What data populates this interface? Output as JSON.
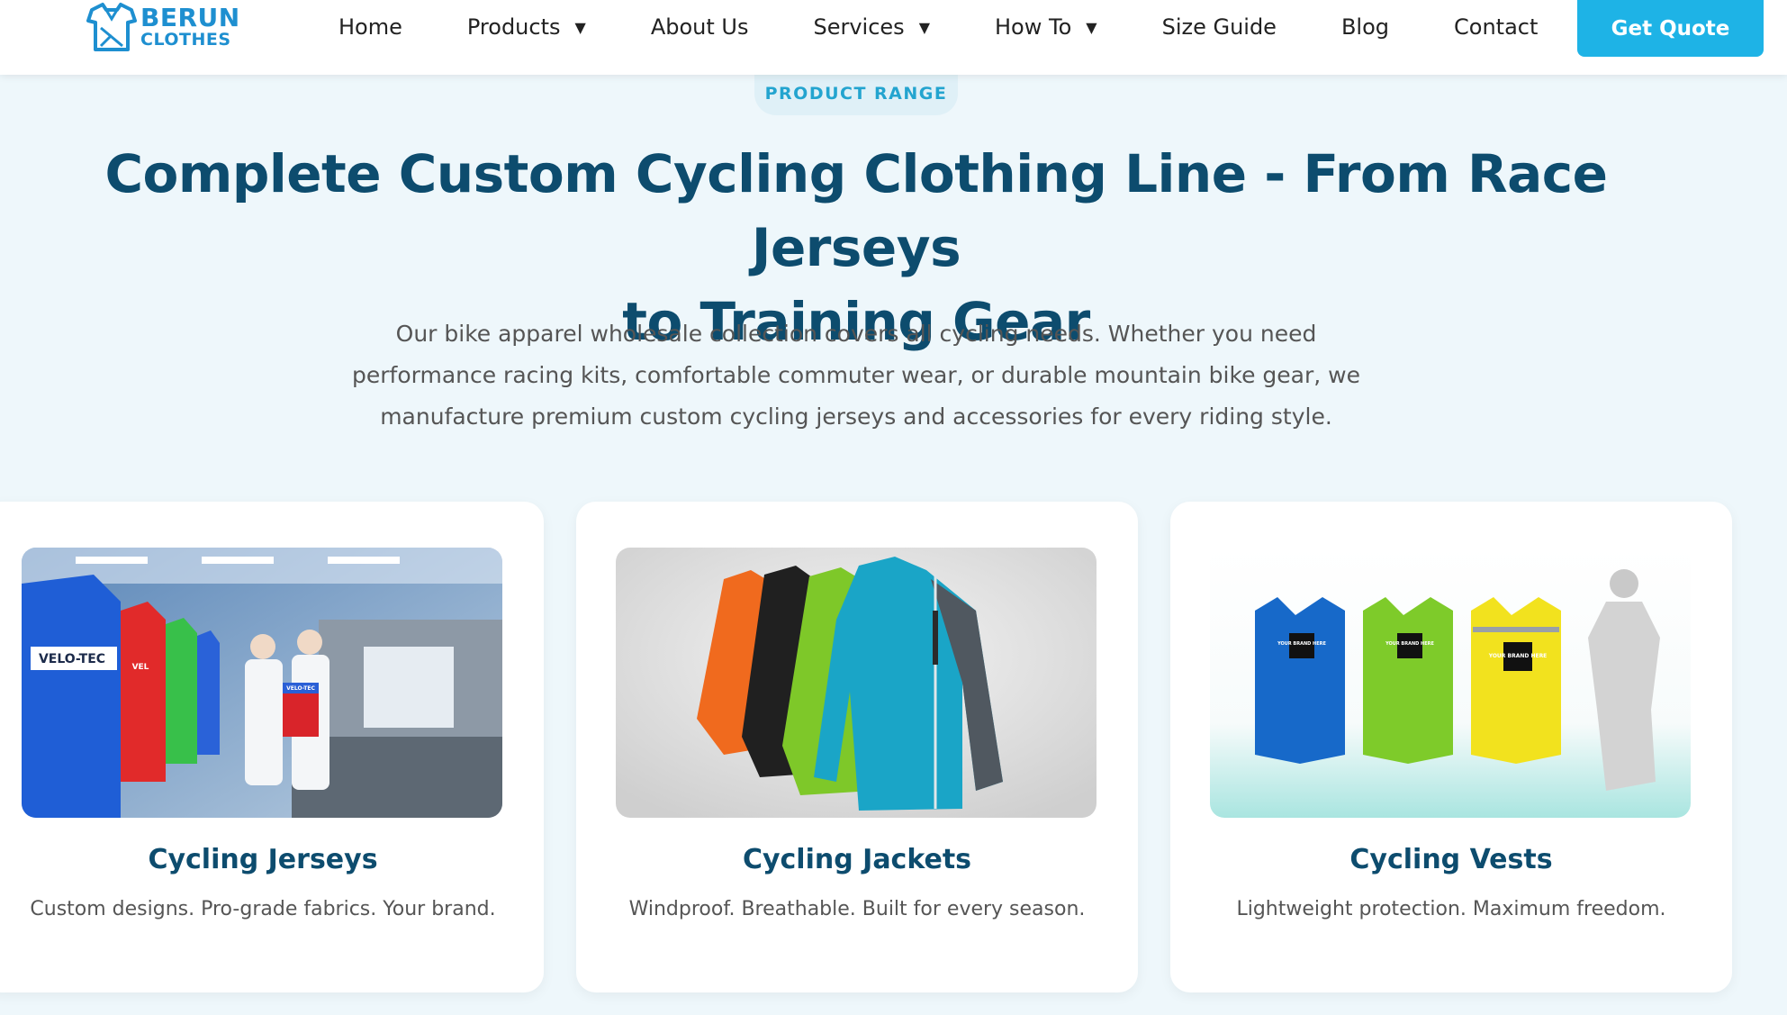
{
  "logo": {
    "brand": "BERUN",
    "sub": "CLOTHES"
  },
  "nav": {
    "items": [
      {
        "label": "Home"
      },
      {
        "label": "Products",
        "caret": "▼"
      },
      {
        "label": "About Us"
      },
      {
        "label": "Services",
        "caret": "▼"
      },
      {
        "label": "How To",
        "caret": "▼"
      },
      {
        "label": "Size Guide"
      },
      {
        "label": "Blog"
      },
      {
        "label": "Contact"
      }
    ],
    "cta": "Get Quote"
  },
  "hero": {
    "badge": "PRODUCT RANGE",
    "title_line1": "Complete Custom Cycling Clothing Line - From Race Jerseys",
    "title_line2": "to Training Gear",
    "desc_line1": "Our bike apparel wholesale collection covers all cycling needs. Whether you need",
    "desc_line2": "performance racing kits, comfortable commuter wear, or durable mountain bike gear, we",
    "desc_line3": "manufacture premium custom cycling jerseys and accessories for every riding style."
  },
  "cards": [
    {
      "title": "Cycling Jerseys",
      "desc": "Custom designs. Pro-grade fabrics. Your brand.",
      "image_text": {
        "jersey_1": "VELO-TEC",
        "jersey_2": "VEL",
        "jersey_3": "VELO-TEC"
      }
    },
    {
      "title": "Cycling Jackets",
      "desc": "Windproof. Breathable. Built for every season."
    },
    {
      "title": "Cycling Vests",
      "desc": "Lightweight protection. Maximum freedom.",
      "image_text": {
        "vest_1": "YOUR BRAND HERE",
        "vest_2": "YOUR BRAND HERE",
        "vest_3": "YOUR BRAND HERE"
      }
    }
  ],
  "colors": {
    "brand": "#1e8fd0",
    "accent": "#1eb3e6",
    "heading": "#0d4c6e",
    "page_bg": "#eef7fb"
  }
}
